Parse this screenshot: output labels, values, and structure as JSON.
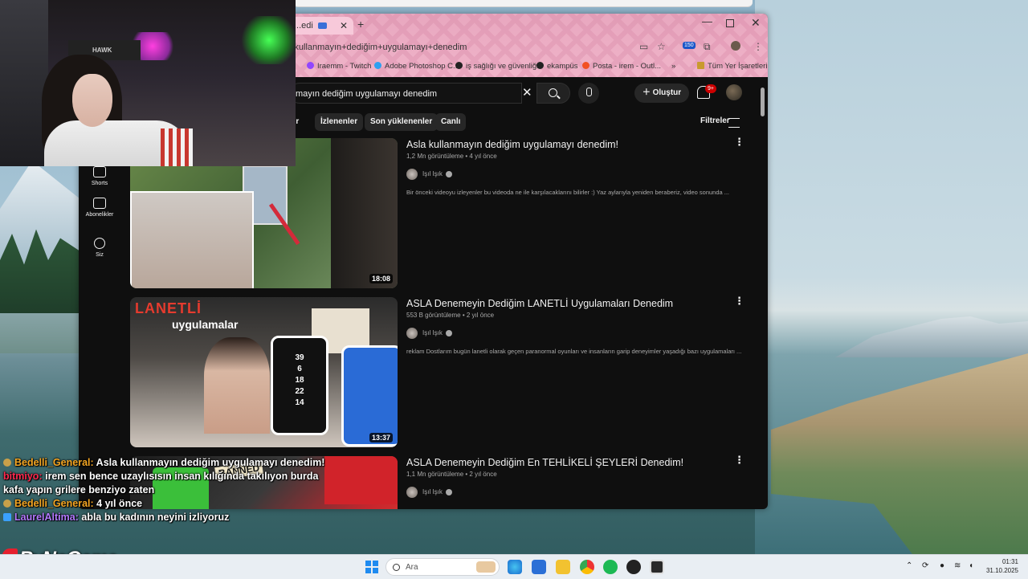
{
  "browser": {
    "tab_title": "...edi",
    "address": "+kullanmayın+dediğim+uygulamayı+denedim",
    "bookmarks": [
      "Iraemm - Twitch",
      "Adobe Photoshop C...",
      "iş sağlığı ve güvenliği",
      "ekampüs",
      "Posta - irem - Outl...",
      "»",
      "Tüm Yer İşaretleri"
    ],
    "ext_badge": "150"
  },
  "youtube": {
    "search_query": "mayın dediğim uygulamayı denedim",
    "create_label": "Oluştur",
    "notif_badge": "9+",
    "chips": [
      "ler",
      "İzlenenler",
      "Son yüklenenler",
      "Canlı"
    ],
    "filters_label": "Filtreler",
    "sidebar": [
      {
        "label": "Shorts",
        "icon": "shorts-icon"
      },
      {
        "label": "Abonelikler",
        "icon": "subscriptions-icon"
      },
      {
        "label": "Siz",
        "icon": "user-icon"
      }
    ],
    "videos": [
      {
        "title": "Asla kullanmayın dediğim uygulamayı denedim!",
        "meta": "1,2 Mn görüntüleme • 4 yıl önce",
        "channel": "Işıl Işık",
        "description": "Bir önceki videoyu izleyenler bu videoda ne ile karşılacaklarını bilirler :) Yaz aylarıyla yeniden beraberiz, video sonunda ...",
        "duration": "18:08"
      },
      {
        "title": "ASLA Denemeyin Dediğim LANETLİ Uygulamaları Denedim",
        "meta": "553 B görüntüleme • 2 yıl önce",
        "channel": "Işıl Işık",
        "description": "reklam Dostlarım bugün lanetli olarak geçen paranormal oyunları ve insanların garip deneyimler yaşadığı bazı uygulamaları ...",
        "duration": "13:37",
        "thumb_title": "LANETLİ",
        "thumb_sub": "uygulamalar",
        "thumb_numbers": "39\n6\n18\n22\n14"
      },
      {
        "title": "ASLA Denemeyin Dediğim En TEHLİKELİ ŞEYLERİ Denedim!",
        "meta": "1,1 Mn görüntüleme • 2 yıl önce",
        "channel": "Işıl Işık",
        "thumb_label": "BANNED"
      }
    ]
  },
  "webcam": {
    "chair_brand": "HAWK"
  },
  "chat": [
    {
      "user": "Bedelli_General:",
      "message": "Asla kullanmayın dediğim uygulamayı denedim!",
      "color": "#f5a623"
    },
    {
      "user": "bitmiyo:",
      "message": "irem sen bence uzaylısısın insan kılığında takılıyon burda kafa yapın grilere benziyo zaten",
      "color": "#ff2a4f"
    },
    {
      "user": "Bedelli_General:",
      "message": "4 yıl önce",
      "color": "#f5a623"
    },
    {
      "user": "LaurelAltima:",
      "message": "abla bu kadının neyini izliyoruz",
      "color": "#b47aff"
    }
  ],
  "brand": "ByNoGame",
  "taskbar": {
    "search_placeholder": "Ara",
    "time": "01:31",
    "date": "31.10.2025"
  }
}
